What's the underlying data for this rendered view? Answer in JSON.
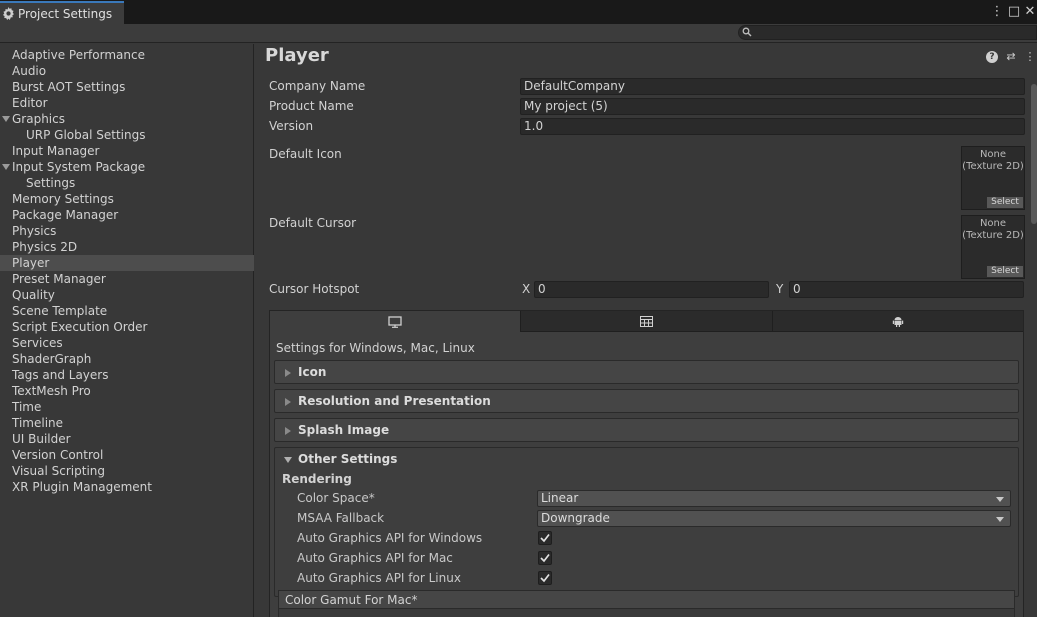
{
  "window": {
    "tab_title": "Project Settings",
    "menu_glyph": "⋮",
    "maximize_glyph": "□",
    "close_glyph": "✕"
  },
  "search": {
    "placeholder": ""
  },
  "sidebar": {
    "items": [
      {
        "label": "Adaptive Performance",
        "indent": 0
      },
      {
        "label": "Audio",
        "indent": 0
      },
      {
        "label": "Burst AOT Settings",
        "indent": 0
      },
      {
        "label": "Editor",
        "indent": 0
      },
      {
        "label": "Graphics",
        "indent": 0,
        "expanded": true
      },
      {
        "label": "URP Global Settings",
        "indent": 1
      },
      {
        "label": "Input Manager",
        "indent": 0
      },
      {
        "label": "Input System Package",
        "indent": 0,
        "expanded": true
      },
      {
        "label": "Settings",
        "indent": 1
      },
      {
        "label": "Memory Settings",
        "indent": 0
      },
      {
        "label": "Package Manager",
        "indent": 0
      },
      {
        "label": "Physics",
        "indent": 0
      },
      {
        "label": "Physics 2D",
        "indent": 0
      },
      {
        "label": "Player",
        "indent": 0,
        "selected": true
      },
      {
        "label": "Preset Manager",
        "indent": 0
      },
      {
        "label": "Quality",
        "indent": 0
      },
      {
        "label": "Scene Template",
        "indent": 0
      },
      {
        "label": "Script Execution Order",
        "indent": 0
      },
      {
        "label": "Services",
        "indent": 0
      },
      {
        "label": "ShaderGraph",
        "indent": 0
      },
      {
        "label": "Tags and Layers",
        "indent": 0
      },
      {
        "label": "TextMesh Pro",
        "indent": 0
      },
      {
        "label": "Time",
        "indent": 0
      },
      {
        "label": "Timeline",
        "indent": 0
      },
      {
        "label": "UI Builder",
        "indent": 0
      },
      {
        "label": "Version Control",
        "indent": 0
      },
      {
        "label": "Visual Scripting",
        "indent": 0
      },
      {
        "label": "XR Plugin Management",
        "indent": 0
      }
    ]
  },
  "player": {
    "title": "Player",
    "help_glyph": "?",
    "settings_glyph": "⇄",
    "menu_glyph": "⋮",
    "company_label": "Company Name",
    "company_value": "DefaultCompany",
    "product_label": "Product Name",
    "product_value": "My project (5)",
    "version_label": "Version",
    "version_value": "1.0",
    "default_icon_label": "Default Icon",
    "default_cursor_label": "Default Cursor",
    "texture_none_line1": "None",
    "texture_none_line2": "(Texture 2D)",
    "texture_select": "Select",
    "cursor_hotspot_label": "Cursor Hotspot",
    "x_label": "X",
    "x_value": "0",
    "y_label": "Y",
    "y_value": "0"
  },
  "platform": {
    "tabs": [
      "monitor-icon",
      "webgl-icon",
      "android-icon"
    ],
    "subtitle": "Settings for Windows, Mac, Linux",
    "foldouts": {
      "icon": "Icon",
      "resolution": "Resolution and Presentation",
      "splash": "Splash Image",
      "other": "Other Settings"
    },
    "rendering": {
      "section": "Rendering",
      "color_space_label": "Color Space*",
      "color_space_value": "Linear",
      "msaa_label": "MSAA Fallback",
      "msaa_value": "Downgrade",
      "auto_win_label": "Auto Graphics API  for Windows",
      "auto_mac_label": "Auto Graphics API  for Mac",
      "auto_linux_label": "Auto Graphics API  for Linux",
      "auto_win_checked": true,
      "auto_mac_checked": true,
      "auto_linux_checked": true,
      "gamut_label": "Color Gamut For Mac*"
    }
  }
}
